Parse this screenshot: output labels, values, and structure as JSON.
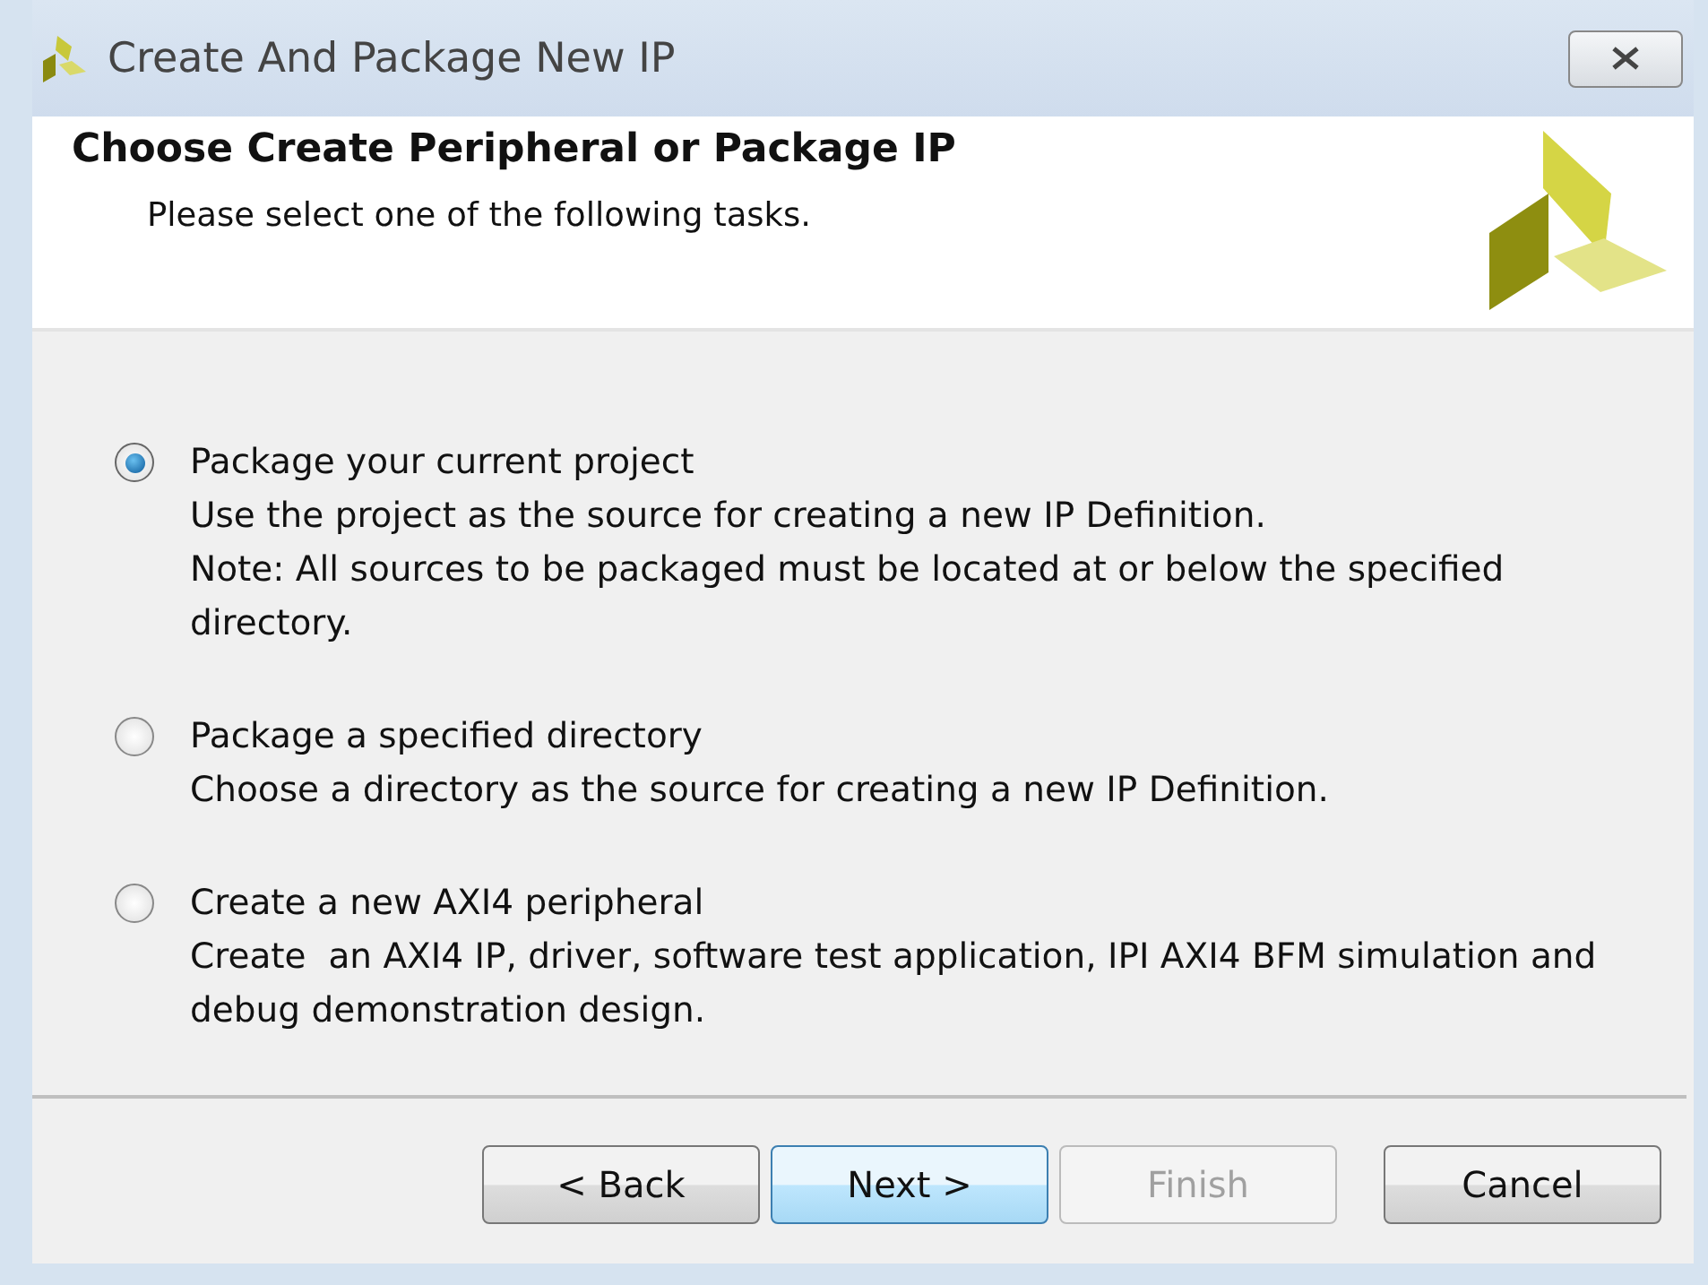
{
  "window": {
    "title": "Create And Package New IP"
  },
  "header": {
    "title": "Choose Create Peripheral or Package IP",
    "subtitle": "Please select one of the following tasks."
  },
  "options": [
    {
      "label": "Package your current project",
      "description": [
        "Use the project as the source for creating a new IP Definition.",
        "Note: All sources to be packaged must be located at or below the specified directory."
      ],
      "selected": true
    },
    {
      "label": "Package a specified directory",
      "description": [
        "Choose a directory as the source for creating a new IP Definition."
      ],
      "selected": false
    },
    {
      "label": "Create a new AXI4 peripheral",
      "description": [
        "Create  an AXI4 IP, driver, software test application, IPI AXI4 BFM simulation and debug demonstration design."
      ],
      "selected": false
    }
  ],
  "buttons": [
    {
      "label": "< Back",
      "default": false,
      "disabled": false
    },
    {
      "label": "Next >",
      "default": true,
      "disabled": false
    },
    {
      "label": "Finish",
      "default": false,
      "disabled": true
    },
    {
      "label": "Cancel",
      "default": false,
      "disabled": false
    }
  ]
}
